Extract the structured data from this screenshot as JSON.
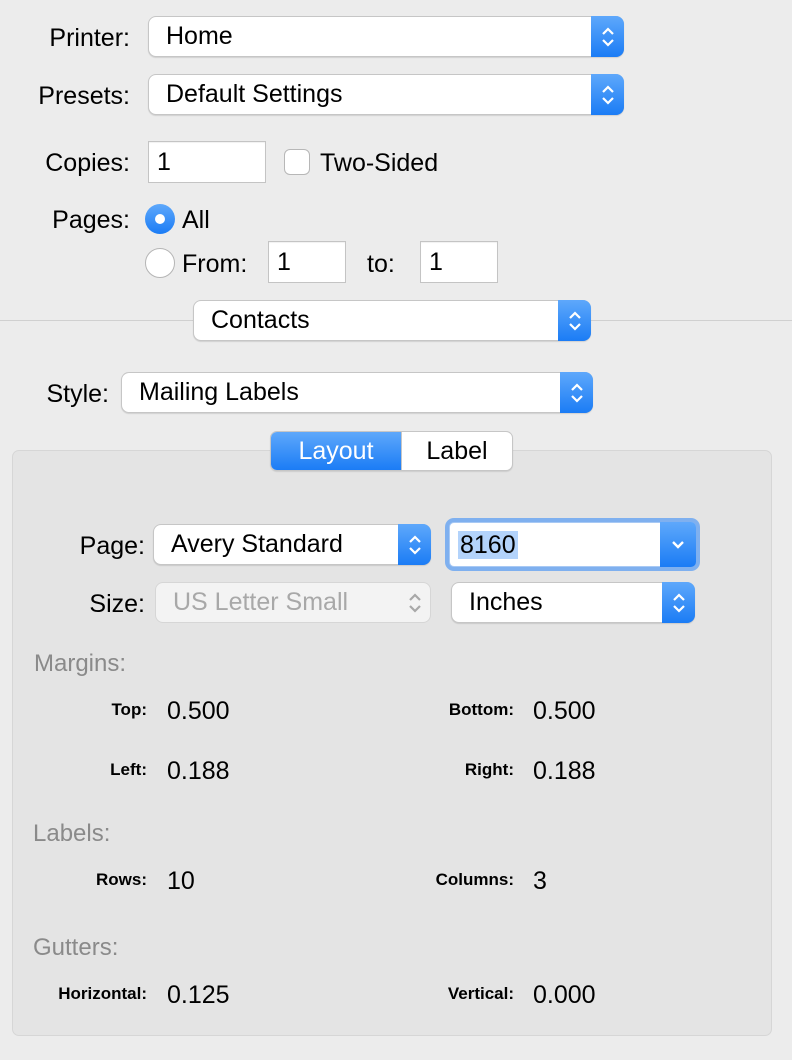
{
  "printer": {
    "label": "Printer:",
    "value": "Home"
  },
  "presets": {
    "label": "Presets:",
    "value": "Default Settings"
  },
  "copies": {
    "label": "Copies:",
    "value": "1",
    "two_sided_label": "Two-Sided",
    "two_sided_checked": false
  },
  "pages": {
    "label": "Pages:",
    "all_label": "All",
    "from_label": "From:",
    "from_value": "1",
    "to_label": "to:",
    "to_value": "1",
    "selected": "All"
  },
  "app_menu": {
    "value": "Contacts"
  },
  "style": {
    "label": "Style:",
    "value": "Mailing Labels"
  },
  "tabs": [
    {
      "label": "Layout",
      "active": true
    },
    {
      "label": "Label",
      "active": false
    }
  ],
  "layout": {
    "page_label": "Page:",
    "page_vendor": "Avery Standard",
    "page_product": "8160",
    "size_label": "Size:",
    "size_value": "US Letter Small",
    "units": "Inches",
    "margins": {
      "title": "Margins:",
      "top_label": "Top:",
      "top": "0.500",
      "bottom_label": "Bottom:",
      "bottom": "0.500",
      "left_label": "Left:",
      "left": "0.188",
      "right_label": "Right:",
      "right": "0.188"
    },
    "labels": {
      "title": "Labels:",
      "rows_label": "Rows:",
      "rows": "10",
      "columns_label": "Columns:",
      "columns": "3"
    },
    "gutters": {
      "title": "Gutters:",
      "horizontal_label": "Horizontal:",
      "horizontal": "0.125",
      "vertical_label": "Vertical:",
      "vertical": "0.000"
    }
  },
  "colors": {
    "accent": "#1b7cf5",
    "background": "#ececec",
    "panel": "#e4e4e4",
    "section_title": "#8a8a8a"
  },
  "icons": {
    "popup": "up-down-chevron-icon",
    "combo": "chevron-down-icon"
  }
}
